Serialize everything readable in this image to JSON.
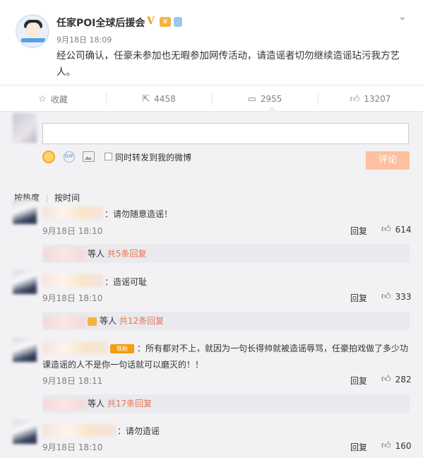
{
  "post": {
    "author": "任家POI全球后援会",
    "verified_mark": "V",
    "time": "9月18日 18:09",
    "text": "经公司确认，任豪未参加也无暇参加网传活动，请造谣者切勿继续造谣玷污我方艺人。"
  },
  "actions": {
    "favorite_label": "收藏",
    "repost_count": "4458",
    "comment_count": "2955",
    "like_count": "13207"
  },
  "composer": {
    "input_value": "",
    "repost_checkbox_label": "同时转发到我的微博",
    "submit_label": "评论"
  },
  "sort": {
    "by_hot": "按热度",
    "by_time": "按时间"
  },
  "comments": [
    {
      "text": "：请勿随意造谣！",
      "time": "9月18日 18:10",
      "reply_label": "回复",
      "likes": "614",
      "more": {
        "suffix": "等人",
        "count_text": "共5条回复"
      }
    },
    {
      "text": "：造谣可耻",
      "time": "9月18日 18:10",
      "reply_label": "回复",
      "likes": "333",
      "more": {
        "suffix": "等人",
        "count_text": "共12条回复"
      }
    },
    {
      "badge": "铁粉",
      "text_line1": "：所有都对不上，就因为一句长得帅就被造谣辱骂，任豪拍戏做了多少功",
      "text_line2": "课造谣的人不是你一句话就可以磨灭的！！",
      "time": "9月18日 18:11",
      "reply_label": "回复",
      "likes": "282",
      "more": {
        "suffix": "等人",
        "count_text": "共17条回复"
      }
    },
    {
      "text": "：请勿造谣",
      "time": "9月18日 18:10",
      "reply_label": "回复",
      "likes": "160"
    }
  ]
}
